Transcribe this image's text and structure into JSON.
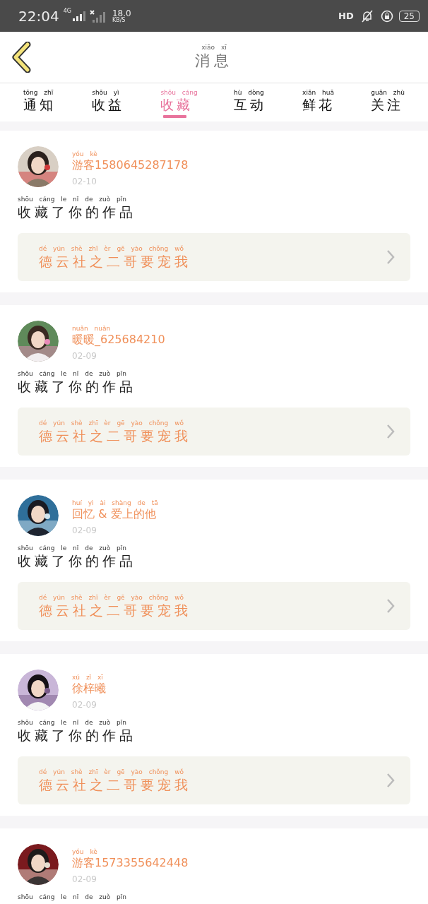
{
  "status_bar": {
    "time": "22:04",
    "network": "4G",
    "speed": "18.0",
    "speed_unit": "KB/S",
    "hd": "HD",
    "battery": "25"
  },
  "header": {
    "title": "消息",
    "title_pinyin": "xiāo xī"
  },
  "tabs": [
    {
      "label": "通知",
      "pinyin": "tōng zhī",
      "selected": false
    },
    {
      "label": "收益",
      "pinyin": "shōu yì",
      "selected": false
    },
    {
      "label": "收藏",
      "pinyin": "shōu cáng",
      "selected": true
    },
    {
      "label": "互动",
      "pinyin": "hù dòng",
      "selected": false
    },
    {
      "label": "鲜花",
      "pinyin": "xiān huā",
      "selected": false
    },
    {
      "label": "关注",
      "pinyin": "guān zhù",
      "selected": false
    }
  ],
  "messages": [
    {
      "name": "游客1580645287178",
      "name_pinyin": "yóu kè",
      "date": "02-10",
      "comment": {
        "text": "收藏了你的作品",
        "pinyin": "shōu cáng le nǐ de zuò pǐn"
      },
      "work": {
        "title": "德云社之二哥要宠我",
        "pinyin": "dé yún shè zhī èr gē yào chǒng wǒ"
      }
    },
    {
      "name": "暖暖_625684210",
      "name_pinyin": "nuǎn nuǎn",
      "date": "02-09",
      "comment": {
        "text": "收藏了你的作品",
        "pinyin": "shōu cáng le nǐ de zuò pǐn"
      },
      "work": {
        "title": "德云社之二哥要宠我",
        "pinyin": "dé yún shè zhī èr gē yào chǒng wǒ"
      }
    },
    {
      "name": "回忆 & 爱上的他",
      "name_pinyin": "huí yì ài shàng de tā",
      "date": "02-09",
      "comment": {
        "text": "收藏了你的作品",
        "pinyin": "shōu cáng le nǐ de zuò pǐn"
      },
      "work": {
        "title": "德云社之二哥要宠我",
        "pinyin": "dé yún shè zhī èr gē yào chǒng wǒ"
      }
    },
    {
      "name": "徐梓曦",
      "name_pinyin": "xú zǐ xī",
      "date": "02-09",
      "comment": {
        "text": "收藏了你的作品",
        "pinyin": "shōu cáng le nǐ de zuò pǐn"
      },
      "work": {
        "title": "德云社之二哥要宠我",
        "pinyin": "dé yún shè zhī èr gē yào chǒng wǒ"
      }
    },
    {
      "name": "游客1573355642448",
      "name_pinyin": "yóu kè",
      "date": "02-09",
      "comment": {
        "pinyin": "shōu cáng le nǐ de zuò pǐn"
      }
    }
  ]
}
